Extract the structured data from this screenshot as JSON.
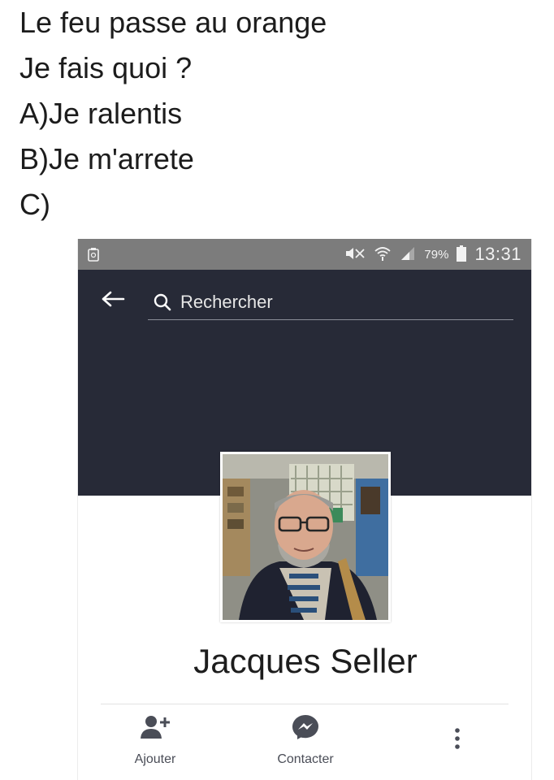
{
  "meme": {
    "lines": [
      "Le feu passe au orange",
      "Je fais quoi ?",
      "A)Je ralentis",
      "B)Je m'arrete",
      "C)"
    ]
  },
  "statusbar": {
    "battery": "79%",
    "time": "13:31",
    "icons": [
      "screenshot-icon",
      "mute-icon",
      "wifi-icon",
      "signal-icon",
      "battery-icon"
    ]
  },
  "header": {
    "search_placeholder": "Rechercher",
    "back_icon": "arrow-left-icon",
    "search_icon": "search-icon"
  },
  "profile": {
    "name": "Jacques Seller"
  },
  "actions": {
    "add_label": "Ajouter",
    "contact_label": "Contacter",
    "add_icon": "add-friend-icon",
    "contact_icon": "messenger-icon",
    "more_icon": "more-vertical-icon"
  },
  "colors": {
    "statusbar": "#7c7c7c",
    "header": "#272a37",
    "icon_accent": "#4a4d57"
  }
}
